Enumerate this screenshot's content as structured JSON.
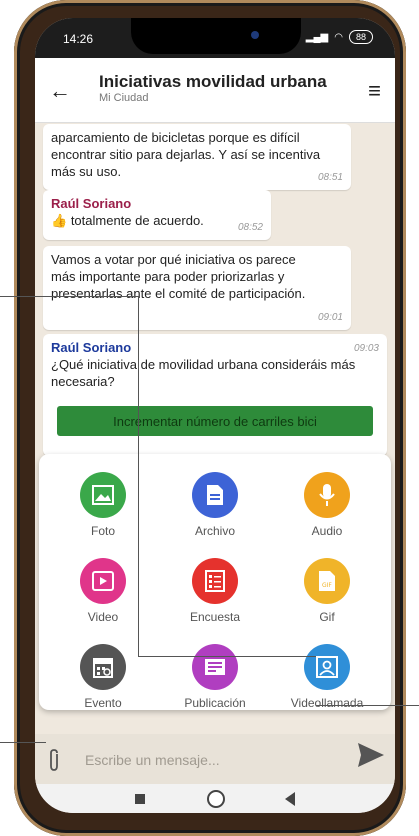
{
  "status": {
    "time": "14:26",
    "battery": "88"
  },
  "header": {
    "title": "Iniciativas movilidad urbana",
    "subtitle": "Mi Ciudad"
  },
  "messages": [
    {
      "text_line1": "aparcamiento de bicicletas porque es difícil",
      "text_line2": "encontrar sitio para dejarlas. Y así se incentiva",
      "text_line3": "más su uso.",
      "time": "08:51"
    },
    {
      "author": "Raúl Soriano",
      "text": "totalmente de acuerdo.",
      "time": "08:52"
    },
    {
      "text_line1": "Vamos a votar por qué iniciativa os parece",
      "text_line2": "más importante para poder priorizarlas y",
      "text_line3": "presentarlas ante el comité de participación.",
      "time": "09:01"
    },
    {
      "author": "Raúl Soriano",
      "text_line1": "¿Qué iniciativa de movilidad urbana consideráis más",
      "text_line2": "necesaria?",
      "time": "09:03"
    }
  ],
  "poll": {
    "option1": "Incrementar número de carriles bici"
  },
  "attach_menu": [
    {
      "label": "Foto",
      "color": "#3aa84a",
      "icon": "image-icon"
    },
    {
      "label": "Archivo",
      "color": "#3d63d6",
      "icon": "document-icon"
    },
    {
      "label": "Audio",
      "color": "#f0a21c",
      "icon": "microphone-icon"
    },
    {
      "label": "Video",
      "color": "#e0358a",
      "icon": "video-icon"
    },
    {
      "label": "Encuesta",
      "color": "#e5322d",
      "icon": "survey-icon"
    },
    {
      "label": "Gif",
      "color": "#f0b429",
      "icon": "gif-icon"
    },
    {
      "label": "Evento",
      "color": "#555555",
      "icon": "calendar-icon"
    },
    {
      "label": "Publicación",
      "color": "#b03ec0",
      "icon": "publication-icon"
    },
    {
      "label": "Videollamada",
      "color": "#2f8fd8",
      "icon": "videocall-icon"
    }
  ],
  "composer": {
    "placeholder": "Escribe un mensaje..."
  }
}
